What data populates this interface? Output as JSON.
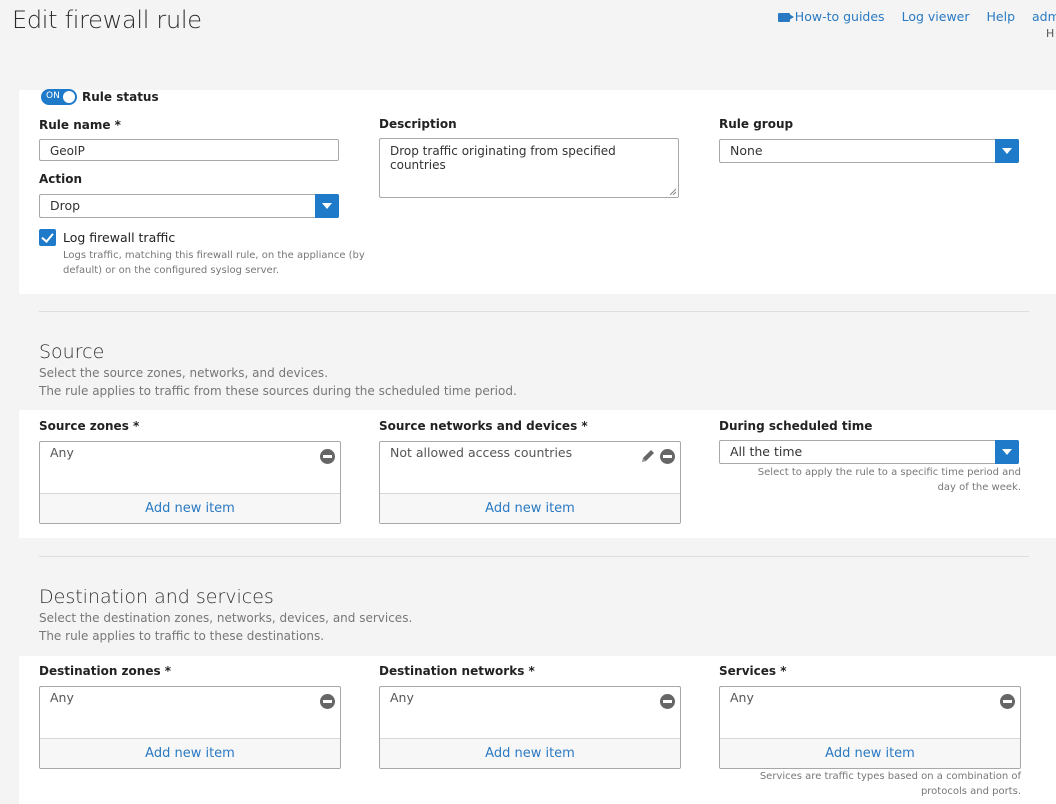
{
  "page": {
    "title": "Edit firewall rule"
  },
  "toplinks": {
    "howto": "How-to guides",
    "logviewer": "Log viewer",
    "help": "Help",
    "user": "admin",
    "sub": "H"
  },
  "rule": {
    "status_toggle": "ON",
    "status_label": "Rule status",
    "name_label": "Rule name *",
    "name_value": "GeoIP",
    "description_label": "Description",
    "description_value": "Drop traffic originating from specified countries",
    "group_label": "Rule group",
    "group_value": "None",
    "action_label": "Action",
    "action_value": "Drop",
    "log_label": "Log firewall traffic",
    "log_help": "Logs traffic, matching this firewall rule, on the appliance (by default) or on the configured syslog server."
  },
  "source": {
    "title": "Source",
    "desc1": "Select the source zones, networks, and devices.",
    "desc2": "The rule applies to traffic from these sources during the scheduled time period.",
    "zones_label": "Source zones *",
    "zones_item": "Any",
    "networks_label": "Source networks and devices *",
    "networks_item": "Not allowed access countries",
    "schedule_label": "During scheduled time",
    "schedule_value": "All the time",
    "schedule_help": "Select to apply the rule to a specific time period and day of the week.",
    "add_item": "Add new item"
  },
  "destination": {
    "title": "Destination and services",
    "desc1": "Select the destination zones, networks, devices, and services.",
    "desc2": "The rule applies to traffic to these destinations.",
    "zones_label": "Destination zones *",
    "zones_item": "Any",
    "networks_label": "Destination networks *",
    "networks_item": "Any",
    "services_label": "Services *",
    "services_item": "Any",
    "services_help": "Services are traffic types based on a combination of protocols and ports.",
    "add_item": "Add new item"
  },
  "colors": {
    "accent": "#1f7bc9",
    "link": "#2a7ac3"
  }
}
